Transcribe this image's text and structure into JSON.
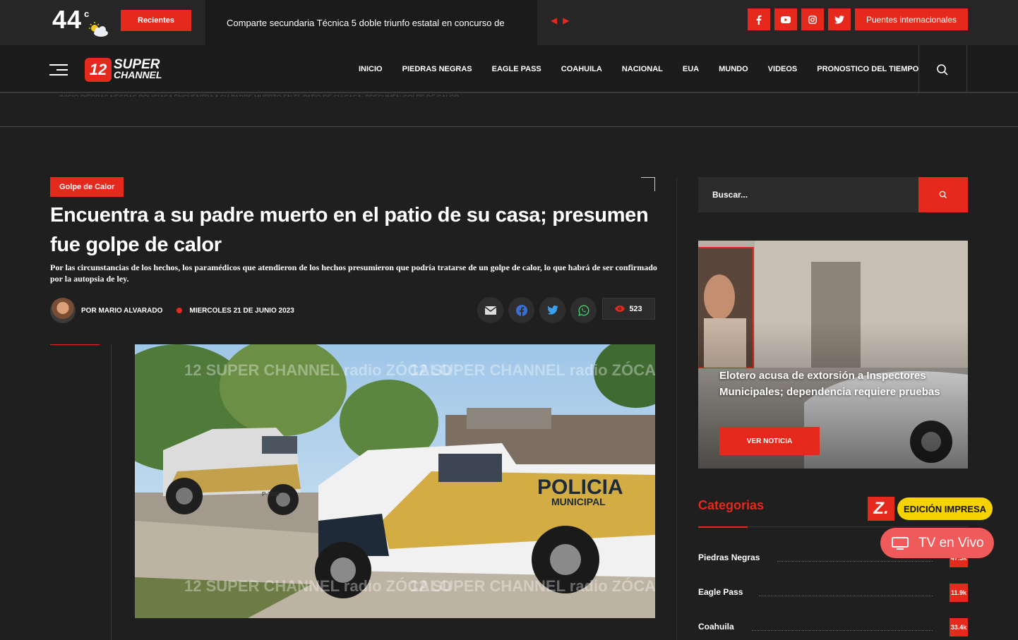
{
  "topbar": {
    "temperature": "44",
    "temperature_unit": "c",
    "recientes_label": "Recientes",
    "ticker_text": "Comparte secundaria Técnica 5 doble triunfo estatal en concurso de",
    "social_icons": [
      "facebook-icon",
      "youtube-icon",
      "instagram-icon",
      "twitter-icon"
    ],
    "puentes_label": "Puentes internacionales"
  },
  "logo": {
    "badge": "12",
    "line1": "SUPER",
    "line2": "CHANNEL"
  },
  "nav": {
    "items": [
      "INICIO",
      "PIEDRAS NEGRAS",
      "EAGLE PASS",
      "COAHUILA",
      "NACIONAL",
      "EUA",
      "MUNDO",
      "VIDEOS",
      "PRONOSTICO DEL TIEMPO"
    ]
  },
  "breadcrumb_ghost": "INICIO     PIEDRAS NEGRAS     POLICIACA     ENCUENTRA A SU PADRE MUERTO EN EL PATIO DE SU CASA; PRESUMEN GOLPE DE CALOR",
  "article": {
    "category": "Golpe de Calor",
    "title": "Encuentra a su padre muerto en el patio de su casa; presumen fue golpe de calor",
    "subtitle": "Por las circunstancias de los hechos, los paramédicos que atendieron de los hechos presumieron que podría tratarse de un golpe de calor, lo que habrá de ser confirmado por la autopsia de ley.",
    "author": "POR MARIO ALVARADO",
    "date": "MIERCOLES 21 DE JUNIO 2023",
    "views": "523",
    "share_icons": [
      "email-icon",
      "facebook-icon",
      "twitter-icon",
      "whatsapp-icon"
    ],
    "hero_vehicle_text": "POLICIA",
    "hero_vehicle_text2": "MUNICIPAL",
    "hero_plate": "P-2597",
    "hero_watermark": "12 SUPER CHANNEL  radio ZÓCALO"
  },
  "sidebar": {
    "search_placeholder": "Buscar...",
    "featured": {
      "title": "Elotero acusa de extorsión a Inspectores Municipales; dependencia requiere pruebas",
      "button": "VER NOTICIA"
    },
    "categories_heading": "Categorias",
    "categories": [
      {
        "name": "Piedras Negras",
        "count": "47.5k"
      },
      {
        "name": "Eagle Pass",
        "count": "11.9k"
      },
      {
        "name": "Coahuila",
        "count": "33.4k"
      }
    ]
  },
  "floating": {
    "z_logo": "Z.",
    "edicion_label": "EDICIÓN IMPRESA",
    "tv_label": "TV en Vivo"
  },
  "colors": {
    "accent": "#e5291c",
    "background": "#1f1f1f",
    "edicion": "#f5d200",
    "tv": "#f05a5a"
  }
}
